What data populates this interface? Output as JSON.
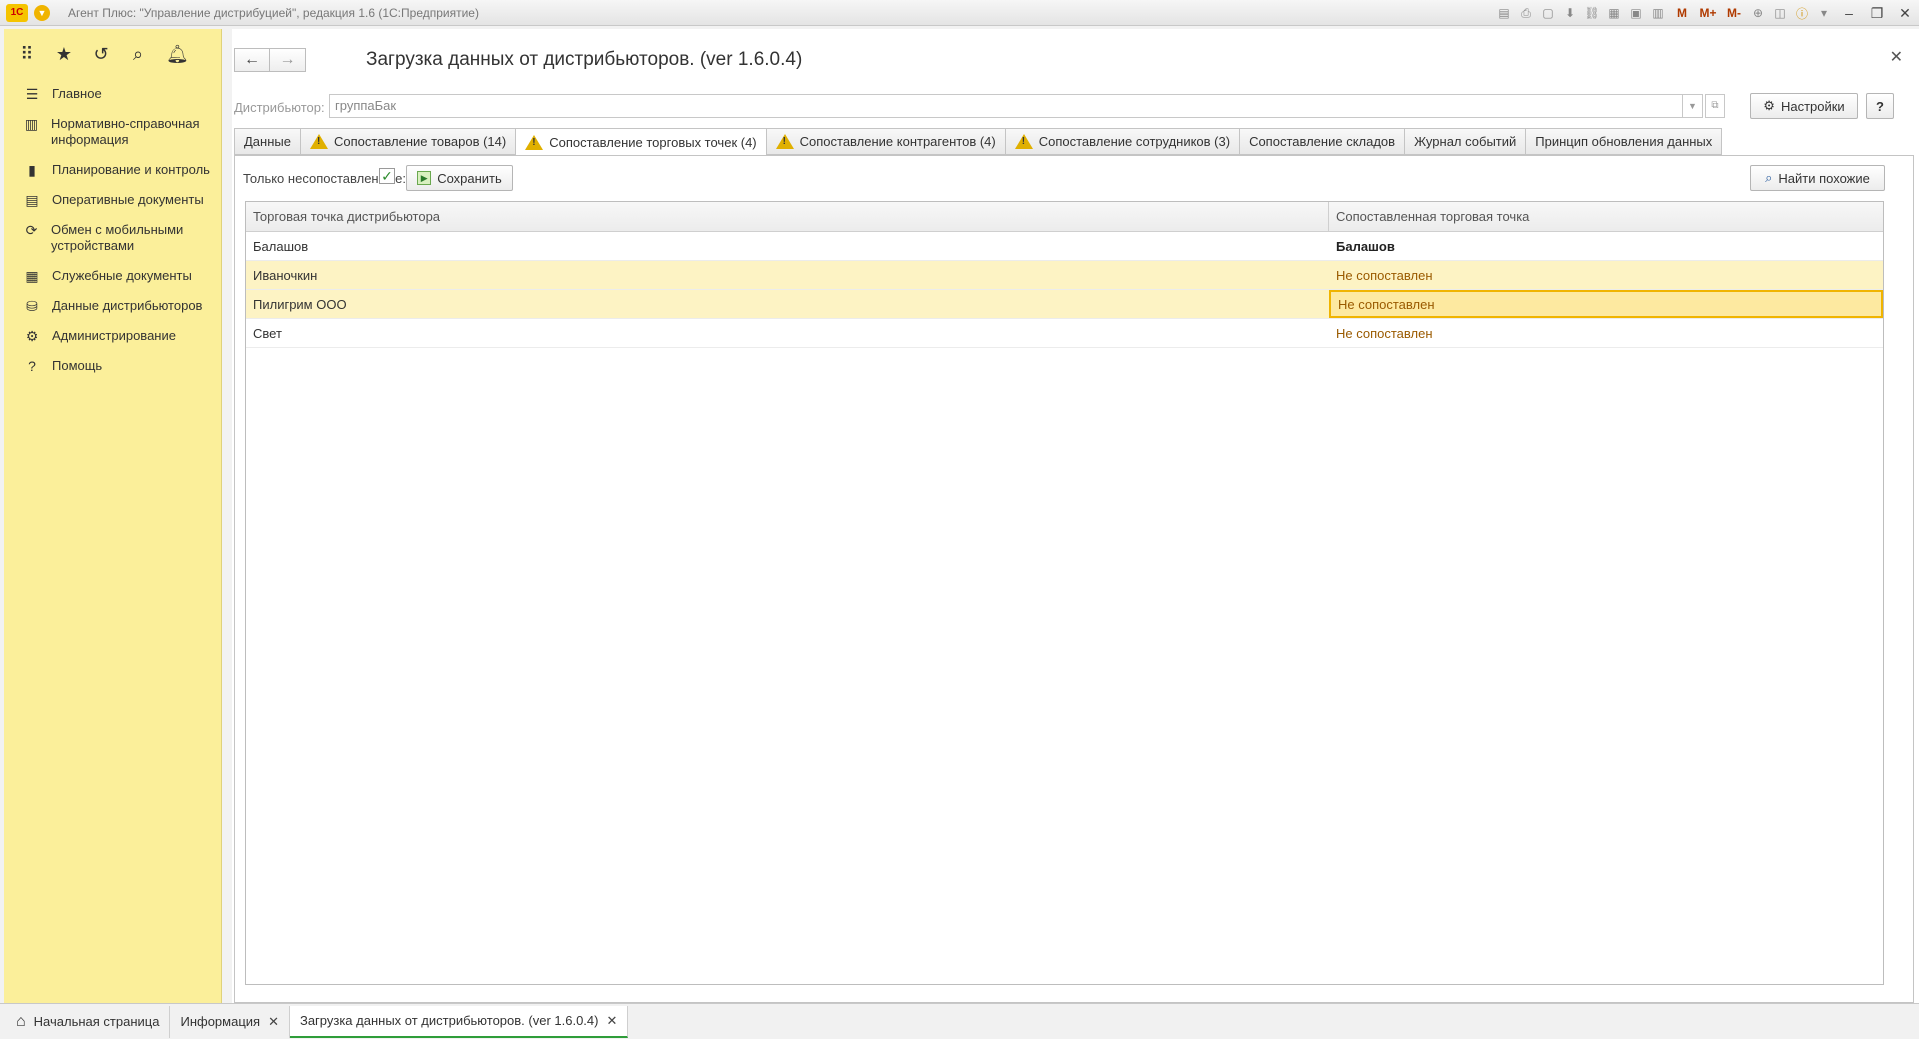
{
  "window": {
    "title": "Агент Плюс: \"Управление дистрибуцией\", редакция 1.6  (1С:Предприятие)",
    "logo": "1С",
    "toolbar_m": [
      "M",
      "M+",
      "M-"
    ]
  },
  "sidebar": {
    "items": [
      {
        "icon": "menu-lines-icon",
        "label": "Главное"
      },
      {
        "icon": "books-icon",
        "label": "Нормативно-справочная информация"
      },
      {
        "icon": "bar-chart-icon",
        "label": "Планирование и контроль"
      },
      {
        "icon": "documents-icon",
        "label": "Оперативные документы"
      },
      {
        "icon": "sync-icon",
        "label": "Обмен с мобильными устройствами"
      },
      {
        "icon": "service-docs-icon",
        "label": "Служебные документы"
      },
      {
        "icon": "distributor-data-icon",
        "label": "Данные дистрибьюторов"
      },
      {
        "icon": "gear-icon",
        "label": "Администрирование"
      },
      {
        "icon": "question-icon",
        "label": "Помощь"
      }
    ]
  },
  "form": {
    "title": "Загрузка данных от дистрибьюторов. (ver 1.6.0.4)",
    "distributor_label": "Дистрибьютор:",
    "distributor_value": "группаБак",
    "settings_label": "Настройки",
    "help_label": "?"
  },
  "tabs": [
    {
      "label": "Данные",
      "warn": false,
      "active": false
    },
    {
      "label": "Сопоставление товаров (14)",
      "warn": true,
      "active": false
    },
    {
      "label": "Сопоставление торговых точек (4)",
      "warn": true,
      "active": true
    },
    {
      "label": "Сопоставление контрагентов (4)",
      "warn": true,
      "active": false
    },
    {
      "label": "Сопоставление сотрудников (3)",
      "warn": true,
      "active": false
    },
    {
      "label": "Сопоставление складов",
      "warn": false,
      "active": false
    },
    {
      "label": "Журнал событий",
      "warn": false,
      "active": false
    },
    {
      "label": "Принцип обновления данных",
      "warn": false,
      "active": false
    }
  ],
  "panel": {
    "only_unmatched_label": "Только несопоставленные:",
    "only_unmatched_checked": true,
    "save_label": "Сохранить",
    "find_similar_label": "Найти похожие"
  },
  "table": {
    "columns": [
      "Торговая точка дистрибьютора",
      "Сопоставленная торговая точка"
    ],
    "rows": [
      {
        "distributor": "Балашов",
        "matched": "Балашов",
        "state": "matched",
        "highlight": false,
        "selected": false
      },
      {
        "distributor": "Иваночкин",
        "matched": "Не сопоставлен",
        "state": "unmatched",
        "highlight": true,
        "selected": false
      },
      {
        "distributor": "Пилигрим ООО",
        "matched": "Не сопоставлен",
        "state": "unmatched",
        "highlight": true,
        "selected": true
      },
      {
        "distributor": "Свет",
        "matched": "Не сопоставлен",
        "state": "unmatched",
        "highlight": false,
        "selected": false
      }
    ]
  },
  "taskbar": {
    "items": [
      {
        "label": "Начальная страница",
        "home": true,
        "closable": false,
        "active": false
      },
      {
        "label": "Информация",
        "home": false,
        "closable": true,
        "active": false
      },
      {
        "label": "Загрузка данных от дистрибьюторов. (ver 1.6.0.4)",
        "home": false,
        "closable": true,
        "active": true
      }
    ]
  },
  "colors": {
    "sidebar_bg": "#fbef9a",
    "highlight_row": "#fdf3c4",
    "unmatched_text": "#9a5a00",
    "active_task_underline": "#2f9d3a",
    "annotation_arrow": "#e53935"
  }
}
